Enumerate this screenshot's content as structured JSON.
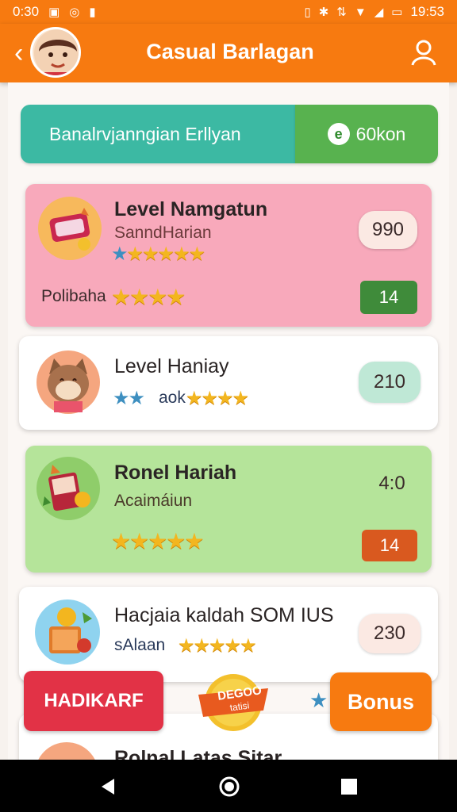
{
  "status": {
    "time": "0:30",
    "clock": "19:53",
    "icons": [
      "image-icon",
      "location-icon",
      "notification-icon",
      "vibrate-icon",
      "bluetooth-icon",
      "data-icon",
      "wifi-icon",
      "signal-icon",
      "battery-icon"
    ]
  },
  "header": {
    "title": "Casual Barlagan",
    "back_icon": "chevron-left-icon",
    "profile_icon": "person-icon"
  },
  "tabs": {
    "left_label": "Banalrvjanngian Erllyan",
    "right_label": "60kon",
    "right_badge": "e"
  },
  "cards": [
    {
      "title": "Level Namgatun",
      "subtitle": "SanndHarian",
      "stars_top": "★★★★★",
      "footer_label": "Polibaha",
      "footer_stars": "★★★★",
      "score": "990",
      "tag": "14",
      "tag_color": "#3f8b3a"
    },
    {
      "title": "Level Haniay",
      "sub_prefix": "★★",
      "sub_text": "aok",
      "stars": "★★★★",
      "score": "210"
    },
    {
      "title": "Ronel Hariah",
      "subtitle": "Acaimáiun",
      "stars": "★★★★★",
      "score": "4:0",
      "tag": "14",
      "tag_color": "#d9591f"
    },
    {
      "title": "Hacjaia kaldah SOM IUS",
      "sub_text": "sAlaan",
      "stars": "★★★★★",
      "score": "230"
    },
    {
      "title": "Rolnal Latas Sitar"
    }
  ],
  "footer": {
    "red_button": "HADIKARF",
    "medal_text": "DEGOO",
    "medal_sub": "tatisi",
    "bonus_button": "Bonus",
    "star_icon": "star-icon"
  },
  "nav": {
    "back": "back-triangle-icon",
    "home": "home-circle-icon",
    "recents": "recents-square-icon"
  },
  "colors": {
    "primary": "#f77a10",
    "teal": "#3cb9a3",
    "green": "#58b24f",
    "pink_card": "#f8a9bb",
    "green_card": "#b5e49a",
    "red": "#e23246"
  }
}
